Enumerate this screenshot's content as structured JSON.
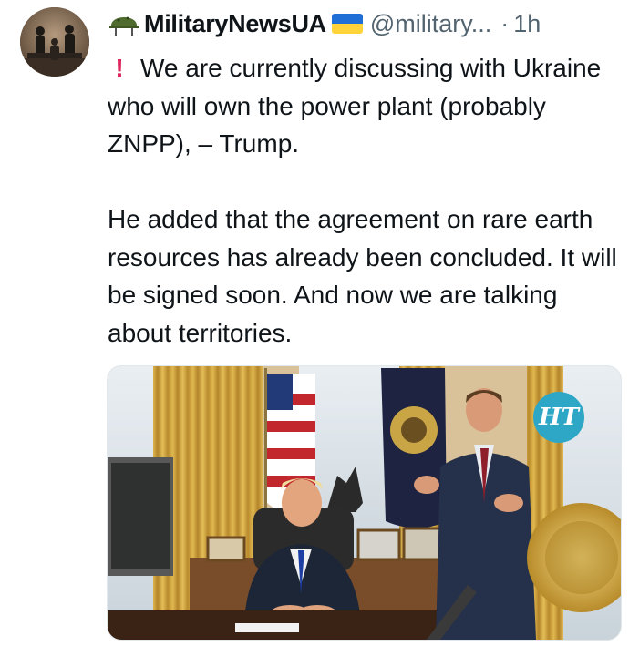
{
  "tweet": {
    "author": {
      "display_name": "MilitaryNewsUA",
      "handle": "@military...",
      "name_icon": "military-helmet-icon",
      "flag_icon": "ukraine-flag-icon"
    },
    "separator": "·",
    "time": "1h",
    "text": {
      "exclamation_icon": "red-exclamation-icon",
      "paragraph_1": "We are currently discussing with Ukraine who will own the power plant (probably ZNPP), – Trump.",
      "paragraph_2": "He added that the agreement on rare earth resources has already been concluded. It will be signed soon. And now we are talking about territories."
    },
    "media": {
      "logo_text": "HT"
    }
  }
}
